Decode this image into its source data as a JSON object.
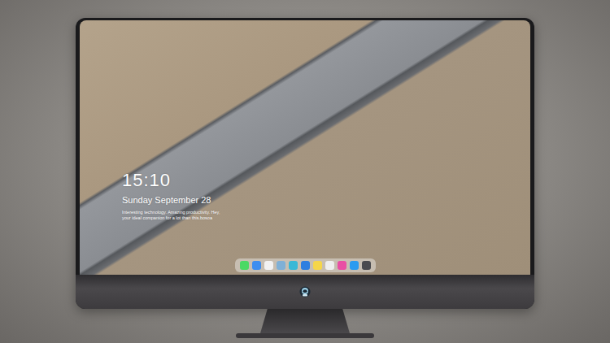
{
  "lockscreen": {
    "time": "15:10",
    "date": "Sunday September 28",
    "tagline": [
      "Interesting technology. Amazing productivity. Hey,",
      "your ideal companion for a lot than this.bosoa"
    ]
  },
  "dock": {
    "apps": [
      {
        "color": "#4cd964"
      },
      {
        "color": "#3d8ef0"
      },
      {
        "color": "#f2f2f2"
      },
      {
        "color": "#7fb0d6"
      },
      {
        "color": "#39b8d6"
      },
      {
        "color": "#2f7fe0"
      },
      {
        "color": "#f5d64a"
      },
      {
        "color": "#eeeeee"
      },
      {
        "color": "#e94fa4"
      },
      {
        "color": "#2c9bf0"
      },
      {
        "color": "#4a4a4e"
      }
    ]
  }
}
